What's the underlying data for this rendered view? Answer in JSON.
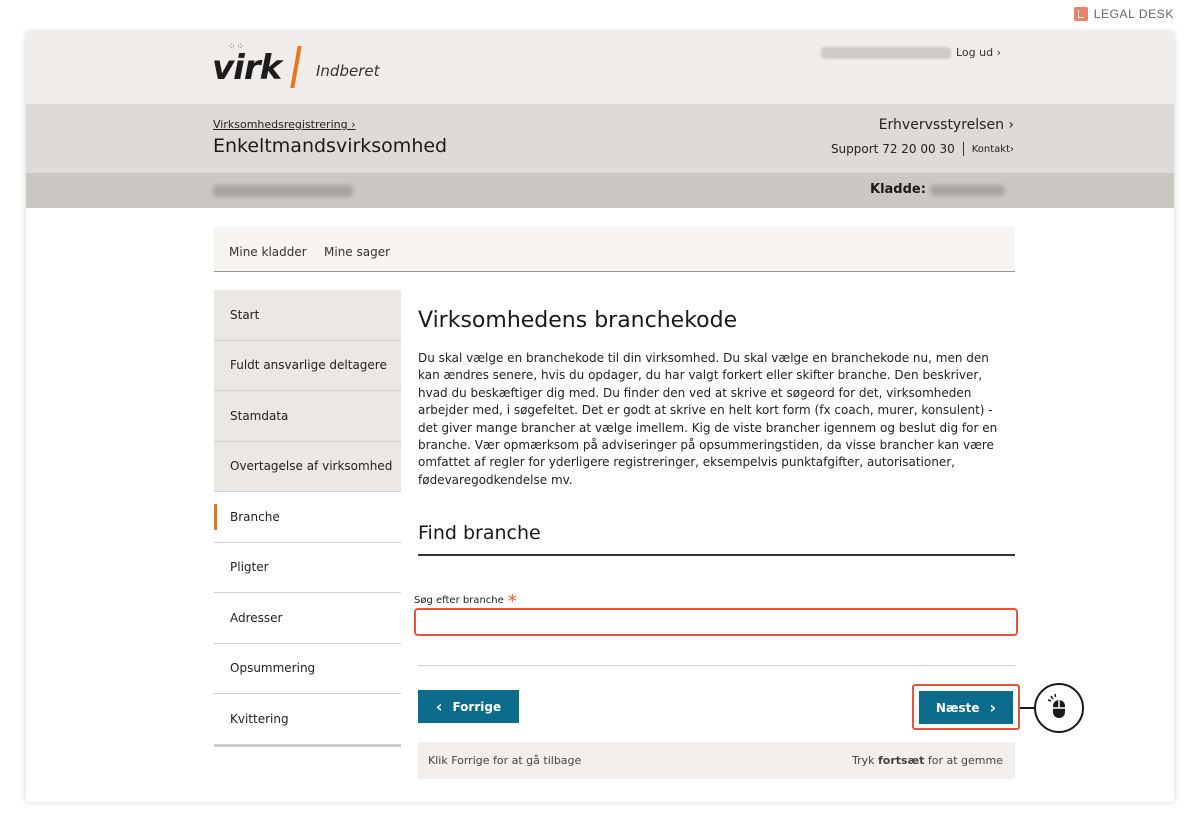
{
  "watermark": {
    "label": "LEGAL DESK",
    "icon": "legal-desk-logo-icon"
  },
  "header": {
    "logo_text": "virk",
    "logo_sub": "Indberet",
    "logout": "Log ud ›"
  },
  "subheader": {
    "breadcrumb": "Virksomhedsregistrering ›",
    "title": "Enkeltmandsvirksomhed",
    "agency": "Erhvervsstyrelsen ›",
    "support": "Support 72 20 00 30",
    "contact": "Kontakt›"
  },
  "draft": {
    "label": "Kladde:"
  },
  "tabs": [
    {
      "label": "Mine kladder"
    },
    {
      "label": "Mine sager"
    }
  ],
  "sidebar": {
    "items": [
      {
        "label": "Start"
      },
      {
        "label": "Fuldt ansvarlige deltagere"
      },
      {
        "label": "Stamdata"
      },
      {
        "label": "Overtagelse af virksomhed"
      },
      {
        "label": "Branche"
      },
      {
        "label": "Pligter"
      },
      {
        "label": "Adresser"
      },
      {
        "label": "Opsummering"
      },
      {
        "label": "Kvittering"
      }
    ]
  },
  "main": {
    "title": "Virksomhedens branchekode",
    "description": "Du skal vælge en branchekode til din virksomhed. Du skal vælge en branchekode nu, men den kan ændres senere, hvis du opdager, du har valgt forkert eller skifter branche. Den beskriver, hvad du beskæftiger dig med. Du finder den ved at skrive et søgeord for det, virksomheden arbejder med, i søgefeltet. Det er godt at skrive en helt kort form (fx coach, murer, konsulent) - det giver mange brancher at vælge imellem. Kig de viste brancher igennem og beslut dig for en branche. Vær opmærksom på adviseringer på opsummeringstiden, da visse brancher kan være omfattet af regler for yderligere registreringer, eksempelvis punktafgifter, autorisationer, fødevaregodkendelse mv.",
    "section_title": "Find branche",
    "search_label": "Søg efter branche",
    "required_mark": "*",
    "search_value": "",
    "prev_label": "Forrige",
    "next_label": "Næste",
    "footer_left": "Klik Forrige for at gå tilbage",
    "footer_right_pre": "Tryk ",
    "footer_right_bold": "fortsæt",
    "footer_right_post": " for at gemme"
  },
  "colors": {
    "accent_orange": "#e8761c",
    "button_blue": "#0b6c8c",
    "highlight_red": "#e4553c"
  }
}
